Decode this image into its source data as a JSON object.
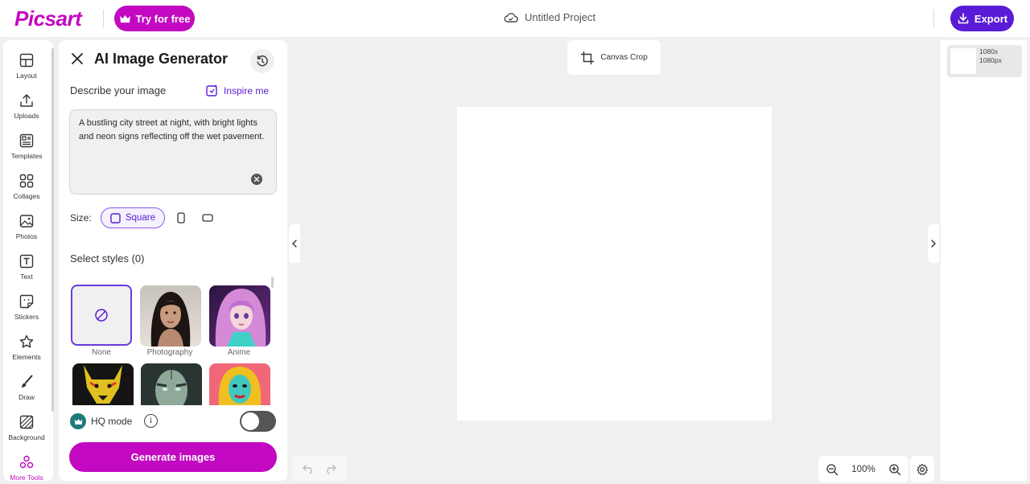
{
  "header": {
    "logo": "Picsart",
    "try_label": "Try for free",
    "project_name": "Untitled Project",
    "export_label": "Export"
  },
  "rail": {
    "items": [
      {
        "label": "Layout",
        "icon": "layout-icon"
      },
      {
        "label": "Uploads",
        "icon": "upload-icon"
      },
      {
        "label": "Templates",
        "icon": "templates-icon"
      },
      {
        "label": "Collages",
        "icon": "collages-icon"
      },
      {
        "label": "Photos",
        "icon": "photos-icon"
      },
      {
        "label": "Text",
        "icon": "text-icon"
      },
      {
        "label": "Stickers",
        "icon": "stickers-icon"
      },
      {
        "label": "Elements",
        "icon": "star-icon"
      },
      {
        "label": "Draw",
        "icon": "brush-icon"
      },
      {
        "label": "Background",
        "icon": "background-icon"
      },
      {
        "label": "More Tools",
        "icon": "more-tools-icon"
      }
    ]
  },
  "panel": {
    "title": "AI Image Generator",
    "describe_label": "Describe your image",
    "inspire_label": "Inspire me",
    "prompt_text": "A bustling city street at night, with bright lights and neon signs reflecting off the wet pavement.",
    "size_label": "Size:",
    "size_selected": "Square",
    "styles_label": "Select styles (0)",
    "styles": [
      {
        "name": "None",
        "selected": true
      },
      {
        "name": "Photography",
        "selected": false
      },
      {
        "name": "Anime",
        "selected": false
      },
      {
        "name": "",
        "selected": false
      },
      {
        "name": "",
        "selected": false
      },
      {
        "name": "",
        "selected": false
      }
    ],
    "hq_label": "HQ mode",
    "hq_enabled": false,
    "info_glyph": "i",
    "generate_label": "Generate images"
  },
  "canvas": {
    "crop_label": "Canvas Crop",
    "zoom": "100%"
  },
  "pages": {
    "size_line1": "1080x",
    "size_line2": "1080px"
  },
  "colors": {
    "brand": "#c209c1",
    "accent": "#5a1bd6"
  }
}
